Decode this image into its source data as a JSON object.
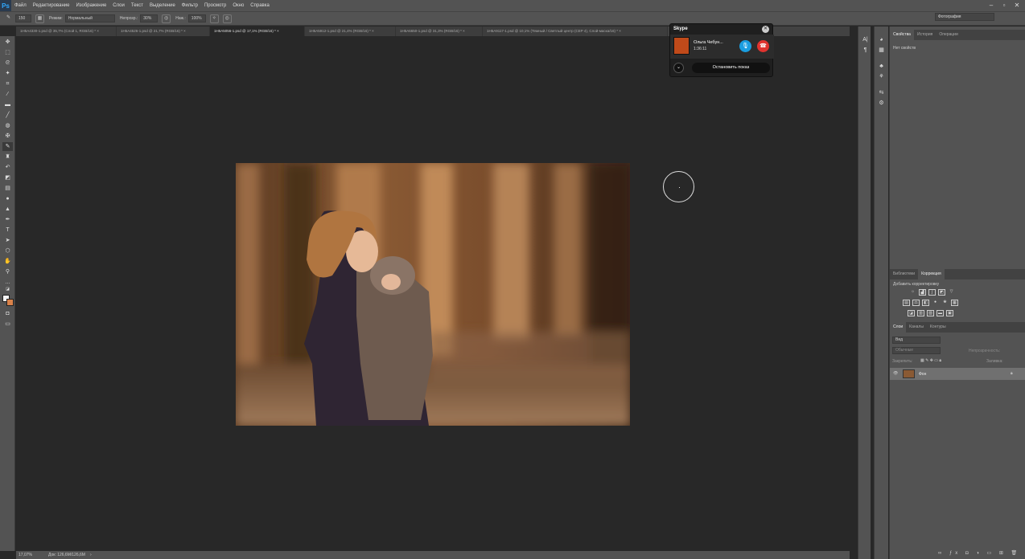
{
  "app": {
    "logo": "Ps"
  },
  "menu": [
    "Файл",
    "Редактирование",
    "Изображение",
    "Слои",
    "Текст",
    "Выделение",
    "Фильтр",
    "Просмотр",
    "Окно",
    "Справка"
  ],
  "options": {
    "mode_label": "Режим:",
    "mode_value": "Нормальный",
    "opacity_label": "Непрозр.:",
    "opacity_value": "30%",
    "flow_label": "Наж.:",
    "flow_value": "100%",
    "brush_size": "150"
  },
  "workspace": "Фотография",
  "tabs": [
    {
      "label": "1H5A4330-1.psd @ 35,7% (Слой 1, RGB/16) *"
    },
    {
      "label": "1H5A4526-1.psd @ 21,7% (RGB/16) *"
    },
    {
      "label": "1H5A5056-1.psd @ 17,1% (RGB/16) *"
    },
    {
      "label": "1H5A5912-1.psd @ 21,4% (RGB/16) *"
    },
    {
      "label": "1H5A6650-1.psd @ 31,3% (RGB/16) *"
    },
    {
      "label": "1H5A9117-1.psd @ 10,1% (Темный / Светлый центр (CEP 4), Слой-маска/16) *"
    }
  ],
  "status": {
    "zoom": "17,07%",
    "doc": "Док: 126,6М/126,6М"
  },
  "skype": {
    "title": "Skype",
    "caller": "Ольга Чебун...",
    "duration": "1:36:11",
    "stop_label": "Остановить показ"
  },
  "panels": {
    "props_tabs": [
      "Свойства",
      "История",
      "Операции"
    ],
    "props_text": "Нет свойств",
    "adj_tabs": [
      "Библиотеки",
      "Коррекция"
    ],
    "adj_title": "Добавить корректировку",
    "layers_tabs": [
      "Слои",
      "Каналы",
      "Контуры"
    ],
    "layers_search": "Вид",
    "blend": "Обычные",
    "opacity_label": "Непрозрачность:",
    "lock_label": "Закрепить:",
    "fill_label": "Заливка:",
    "layer_name": "Фон"
  }
}
